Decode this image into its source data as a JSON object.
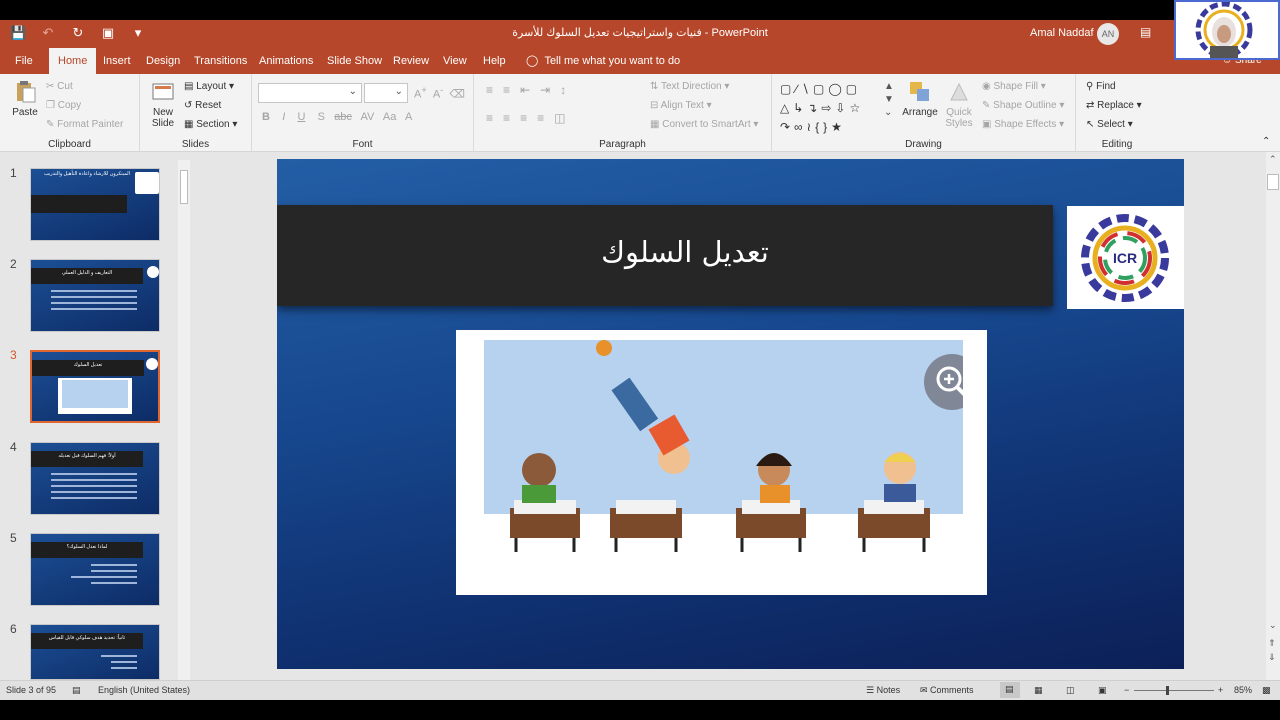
{
  "qat": {
    "icons": [
      "save-icon",
      "undo-icon",
      "redo-icon",
      "start-from-beginning-icon",
      "customize-icon"
    ]
  },
  "window": {
    "title": "فنيات واستراتيجيات تعديل السلوك للأسرة  -  PowerPoint",
    "user": "Amal Naddaf",
    "initials": "AN"
  },
  "tabs": [
    "File",
    "Home",
    "Insert",
    "Design",
    "Transitions",
    "Animations",
    "Slide Show",
    "Review",
    "View",
    "Help"
  ],
  "active_tab": "Home",
  "tellme": "Tell me what you want to do",
  "share": "Share",
  "ribbon": {
    "clipboard": {
      "paste": "Paste",
      "cut": "Cut",
      "copy": "Copy",
      "format_painter": "Format Painter",
      "label": "Clipboard"
    },
    "slides": {
      "new_slide_1": "New",
      "new_slide_2": "Slide",
      "layout": "Layout",
      "reset": "Reset",
      "section": "Section",
      "label": "Slides"
    },
    "font": {
      "label": "Font",
      "buttons": [
        "B",
        "I",
        "U",
        "S",
        "abc",
        "AV",
        "Aa",
        "A"
      ]
    },
    "paragraph": {
      "text_direction": "Text Direction",
      "align_text": "Align Text",
      "smartart": "Convert to SmartArt",
      "label": "Paragraph"
    },
    "drawing": {
      "arrange": "Arrange",
      "quick_styles_1": "Quick",
      "quick_styles_2": "Styles",
      "shape_fill": "Shape Fill",
      "shape_outline": "Shape Outline",
      "shape_effects": "Shape Effects",
      "label": "Drawing"
    },
    "editing": {
      "find": "Find",
      "replace": "Replace",
      "select": "Select",
      "label": "Editing"
    }
  },
  "thumbnails": [
    {
      "num": "1",
      "title": "المبتكرون للارشاد واعادة التأهيل والتدريب"
    },
    {
      "num": "2",
      "title": "التعاريف و الدليل العملي"
    },
    {
      "num": "3",
      "title": "تعديل السلوك"
    },
    {
      "num": "4",
      "title": "أولاً: فهم السلوك قبل تعديله"
    },
    {
      "num": "5",
      "title": "لماذا نعدل السلوك؟"
    },
    {
      "num": "6",
      "title": "ثانياً: تحديد هدف سلوكي قابل للقياس"
    }
  ],
  "slide": {
    "title": "تعديل السلوك",
    "logo_text": "ICR"
  },
  "status": {
    "slide_info": "Slide 3 of 95",
    "language": "English (United States)",
    "notes": "Notes",
    "comments": "Comments",
    "zoom": "85%"
  }
}
